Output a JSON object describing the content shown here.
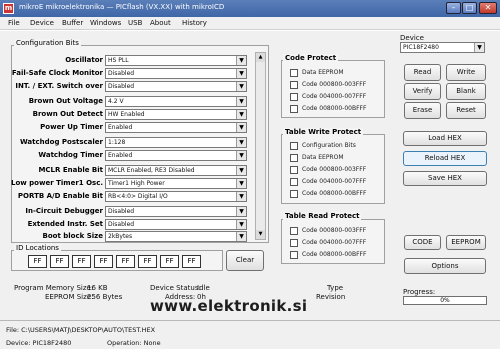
{
  "window": {
    "title": "mikroE mikroelektronika — PICflash (VX.XX) with mikroICD",
    "app_icon_glyph": "m"
  },
  "menu": [
    "File",
    "Device",
    "Buffer",
    "Windows",
    "USB",
    "About",
    "History"
  ],
  "config_bits": {
    "title": "Configuration Bits",
    "rows": [
      {
        "label": "Oscillator",
        "value": "HS PLL"
      },
      {
        "label": "Fail-Safe Clock Monitor",
        "value": "Disabled"
      },
      {
        "label": "INT. / EXT. Switch over",
        "value": "Disabled"
      },
      {
        "label": "Brown Out Voltage",
        "value": "4.2 V"
      },
      {
        "label": "Brown Out Detect",
        "value": "HW Enabled"
      },
      {
        "label": "Power Up Timer",
        "value": "Enabled"
      },
      {
        "label": "Watchdog Postscaler",
        "value": "1:128"
      },
      {
        "label": "Watchdog Timer",
        "value": "Enabled"
      },
      {
        "label": "MCLR Enable Bit",
        "value": "MCLR Enabled, RE3 Disabled"
      },
      {
        "label": "Low power Timer1 Osc.",
        "value": "Timer1 High Power"
      },
      {
        "label": "PORTB A/D Enable Bit",
        "value": "RB<4:0> Digital I/O"
      },
      {
        "label": "In-Circuit Debugger",
        "value": "Disabled"
      },
      {
        "label": "Extended Instr. Set",
        "value": "Disabled"
      },
      {
        "label": "Boot block Size",
        "value": "2kBytes"
      }
    ]
  },
  "id_locations": {
    "title": "ID Locations",
    "values": [
      "FF",
      "FF",
      "FF",
      "FF",
      "FF",
      "FF",
      "FF",
      "FF"
    ],
    "clear_label": "Clear"
  },
  "code_protect": {
    "title": "Code Protect",
    "items": [
      "Data EEPROM",
      "Code 000800-003FFF",
      "Code 004000-007FFF",
      "Code 008000-00BFFF"
    ]
  },
  "table_write_protect": {
    "title": "Table Write Protect",
    "items": [
      "Configuration Bits",
      "Data EEPROM",
      "Code 000800-003FFF",
      "Code 004000-007FFF",
      "Code 008000-00BFFF"
    ]
  },
  "table_read_protect": {
    "title": "Table Read Protect",
    "items": [
      "Code 000800-003FFF",
      "Code 004000-007FFF",
      "Code 008000-00BFFF"
    ]
  },
  "device": {
    "label": "Device",
    "value": "PIC18F2480"
  },
  "buttons": {
    "read": "Read",
    "write": "Write",
    "verify": "Verify",
    "blank": "Blank",
    "erase": "Erase",
    "reset": "Reset",
    "load_hex": "Load HEX",
    "reload_hex": "Reload HEX",
    "save_hex": "Save HEX",
    "code": "CODE",
    "eeprom": "EEPROM",
    "options": "Options"
  },
  "info": {
    "program_memory_size_label": "Program Memory Size:",
    "program_memory_size_value": "16 KB",
    "eeprom_size_label": "EEPROM Size:",
    "eeprom_size_value": "256 Bytes",
    "device_status_label": "Device Status:",
    "device_status_value": "Idle",
    "address_label": "Address:",
    "address_value": "0h",
    "type_label": "Type",
    "revision_label": "Revision"
  },
  "progress": {
    "label": "Progress:",
    "value": 0,
    "text": "0%"
  },
  "status": {
    "file": "File: C:\\USERS\\MATJ\\DESKTOP\\AUTO\\TEST.HEX",
    "device": "Device: PIC18F2480",
    "operation": "Operation: None"
  },
  "watermark": "www.elektronik.si"
}
